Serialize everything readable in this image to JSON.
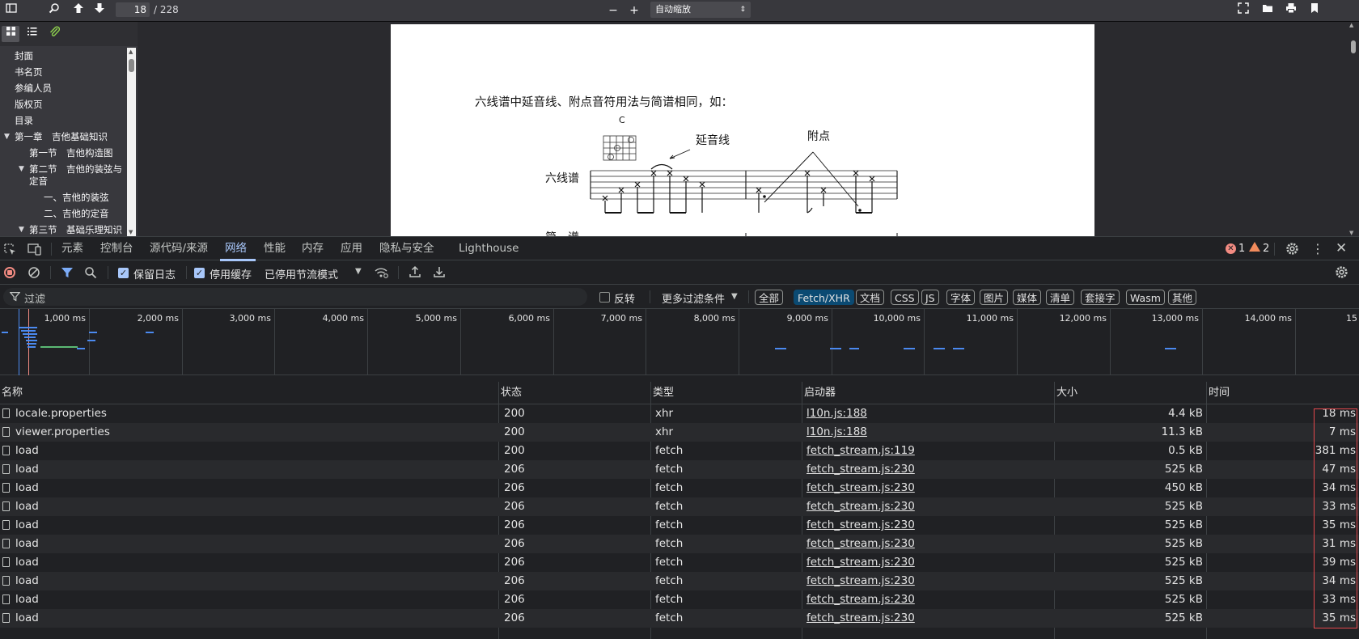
{
  "viewer": {
    "page_number": "18",
    "page_total": "/ 228",
    "zoom": "自动缩放",
    "outline": [
      {
        "label": "封面",
        "level": 0,
        "toggle": ""
      },
      {
        "label": "书名页",
        "level": 0,
        "toggle": ""
      },
      {
        "label": "参编人员",
        "level": 0,
        "toggle": ""
      },
      {
        "label": "版权页",
        "level": 0,
        "toggle": ""
      },
      {
        "label": "目录",
        "level": 0,
        "toggle": ""
      },
      {
        "label": "第一章　吉他基础知识",
        "level": 0,
        "toggle": "▼"
      },
      {
        "label": "第一节　吉他构造图",
        "level": 1,
        "toggle": ""
      },
      {
        "label": "第二节　吉他的装弦与",
        "label2": "定音",
        "level": 1,
        "toggle": "▼"
      },
      {
        "label": "一、吉他的装弦",
        "level": 2,
        "toggle": ""
      },
      {
        "label": "二、吉他的定音",
        "level": 2,
        "toggle": ""
      },
      {
        "label": "第三节　基础乐理知识",
        "level": 1,
        "toggle": "▼"
      }
    ],
    "page_content": {
      "paragraph": "六线谱中延音线、附点音符用法与简谱相同，如：",
      "chord_name": "C",
      "tie_label": "延音线",
      "dot_label": "附点",
      "tab_label": "六线谱",
      "jianpu_label": "简　谱"
    }
  },
  "devtools": {
    "tabs": [
      "元素",
      "控制台",
      "源代码/来源",
      "网络",
      "性能",
      "内存",
      "应用",
      "隐私与安全",
      "Lighthouse"
    ],
    "selected_tab": "网络",
    "error_count": "1",
    "warning_count": "2",
    "toolbar": {
      "preserve_log": "保留日志",
      "disable_cache": "停用缓存",
      "throttle": "已停用节流模式"
    },
    "filter": {
      "placeholder": "过滤",
      "invert": "反转",
      "more_filters": "更多过滤条件",
      "types": [
        "全部",
        "Fetch/XHR",
        "文档",
        "CSS",
        "JS",
        "字体",
        "图片",
        "媒体",
        "清单",
        "套接字",
        "Wasm",
        "其他"
      ],
      "selected_type": "Fetch/XHR"
    },
    "overview_ticks": [
      "1,000 ms",
      "2,000 ms",
      "3,000 ms",
      "4,000 ms",
      "5,000 ms",
      "6,000 ms",
      "7,000 ms",
      "8,000 ms",
      "9,000 ms",
      "10,000 ms",
      "11,000 ms",
      "12,000 ms",
      "13,000 ms",
      "14,000 ms",
      "15"
    ],
    "columns": [
      "名称",
      "状态",
      "类型",
      "启动器",
      "大小",
      "时间"
    ],
    "requests": [
      {
        "name": "locale.properties",
        "status": "200",
        "type": "xhr",
        "initiator": "l10n.js:188",
        "size": "4.4 kB",
        "time": "18 ms"
      },
      {
        "name": "viewer.properties",
        "status": "200",
        "type": "xhr",
        "initiator": "l10n.js:188",
        "size": "11.3 kB",
        "time": "7 ms"
      },
      {
        "name": "load",
        "status": "200",
        "type": "fetch",
        "initiator": "fetch_stream.js:119",
        "size": "0.5 kB",
        "time": "381 ms"
      },
      {
        "name": "load",
        "status": "206",
        "type": "fetch",
        "initiator": "fetch_stream.js:230",
        "size": "525 kB",
        "time": "47 ms"
      },
      {
        "name": "load",
        "status": "206",
        "type": "fetch",
        "initiator": "fetch_stream.js:230",
        "size": "450 kB",
        "time": "34 ms"
      },
      {
        "name": "load",
        "status": "206",
        "type": "fetch",
        "initiator": "fetch_stream.js:230",
        "size": "525 kB",
        "time": "33 ms"
      },
      {
        "name": "load",
        "status": "206",
        "type": "fetch",
        "initiator": "fetch_stream.js:230",
        "size": "525 kB",
        "time": "35 ms"
      },
      {
        "name": "load",
        "status": "206",
        "type": "fetch",
        "initiator": "fetch_stream.js:230",
        "size": "525 kB",
        "time": "31 ms"
      },
      {
        "name": "load",
        "status": "206",
        "type": "fetch",
        "initiator": "fetch_stream.js:230",
        "size": "525 kB",
        "time": "39 ms"
      },
      {
        "name": "load",
        "status": "206",
        "type": "fetch",
        "initiator": "fetch_stream.js:230",
        "size": "525 kB",
        "time": "34 ms"
      },
      {
        "name": "load",
        "status": "206",
        "type": "fetch",
        "initiator": "fetch_stream.js:230",
        "size": "525 kB",
        "time": "33 ms"
      },
      {
        "name": "load",
        "status": "206",
        "type": "fetch",
        "initiator": "fetch_stream.js:230",
        "size": "525 kB",
        "time": "35 ms"
      }
    ]
  },
  "colors": {
    "accent": "#a8c7fa",
    "highlight_box": "#e5484d",
    "error": "#f28b82",
    "warning": "#fdd663"
  }
}
